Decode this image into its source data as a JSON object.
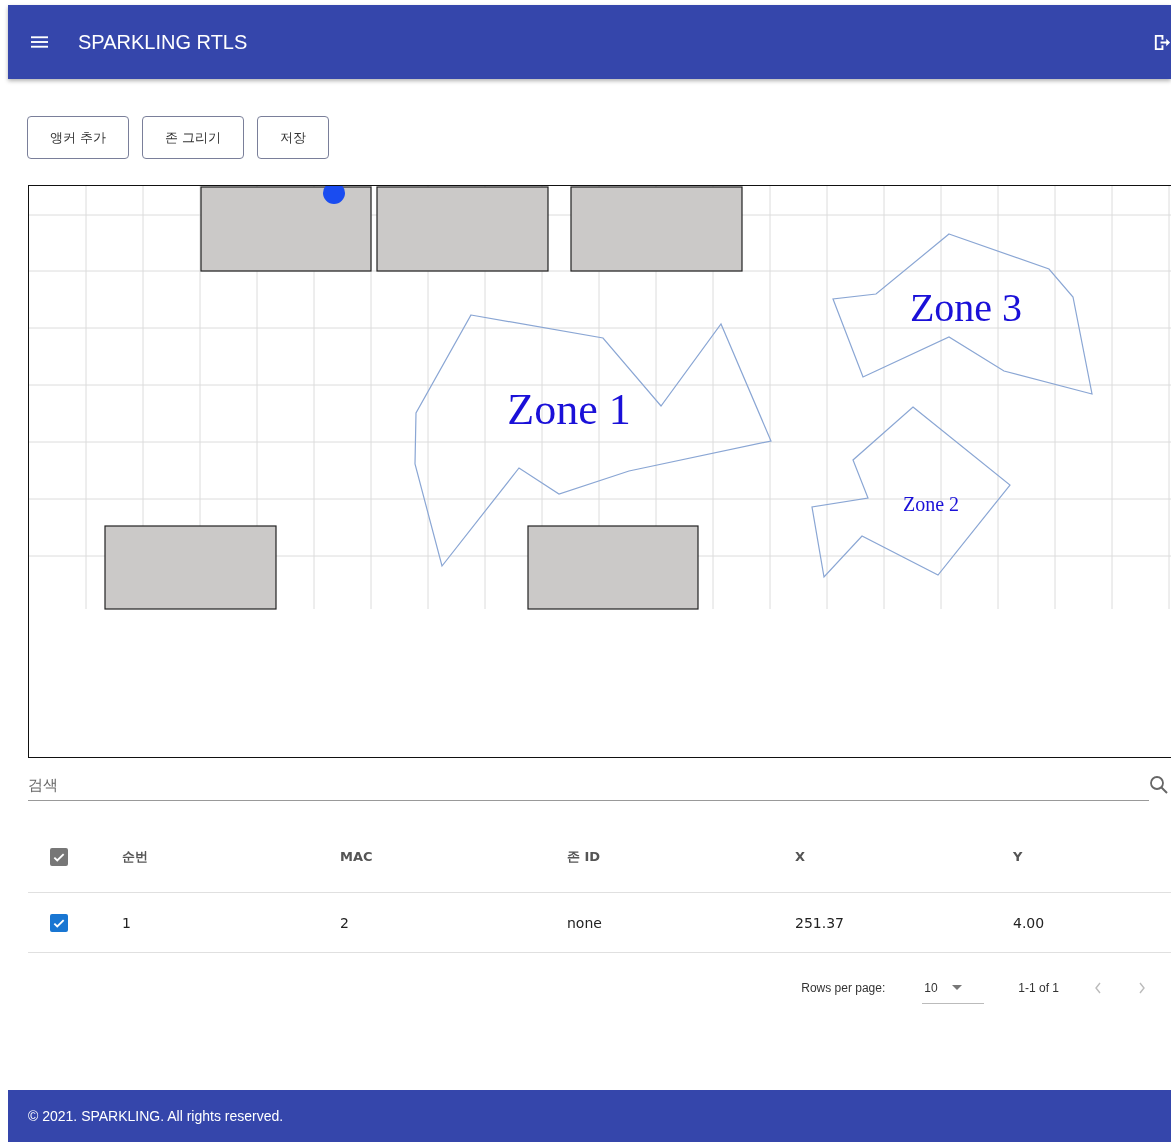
{
  "app_bar": {
    "title": "SPARKLING RTLS"
  },
  "toolbar": {
    "buttons": [
      "앵커 추가",
      "존 그리기",
      "저장"
    ]
  },
  "map": {
    "zones": [
      {
        "name": "Zone 1"
      },
      {
        "name": "Zone 2"
      },
      {
        "name": "Zone 3"
      }
    ]
  },
  "search": {
    "placeholder": "검색"
  },
  "table": {
    "select_all": {
      "checked": true
    },
    "columns": [
      "순번",
      "MAC",
      "존 ID",
      "X",
      "Y"
    ],
    "rows": [
      {
        "selected": true,
        "cells": [
          "1",
          "2",
          "none",
          "251.37",
          "4.00"
        ]
      }
    ]
  },
  "pagination": {
    "rows_per_page_label": "Rows per page:",
    "rows_per_page": "10",
    "range": "1-1 of 1"
  },
  "footer": {
    "text": "© 2021. SPARKLING. All rights reserved."
  }
}
